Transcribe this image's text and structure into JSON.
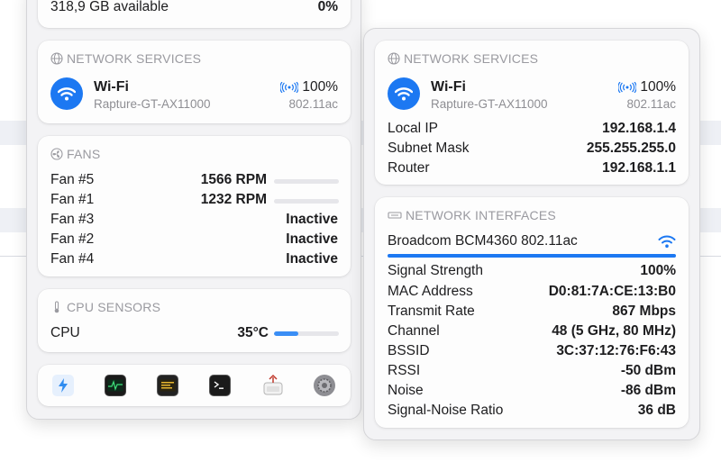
{
  "colors": {
    "accent": "#1c78f2",
    "header_text": "#9a9aa0",
    "card_bg": "#fdfdfd",
    "panel_bg": "#f3f3f5"
  },
  "left_panel": {
    "storage": {
      "available": "318,9 GB available",
      "percent": "0%"
    },
    "network_services": {
      "header": "NETWORK SERVICES",
      "wifi": {
        "name": "Wi-Fi",
        "ssid": "Rapture-GT-AX11000",
        "signal": "100%",
        "standard": "802.11ac"
      }
    },
    "fans": {
      "header": "FANS",
      "items": [
        {
          "name": "Fan #5",
          "value": "1566 RPM",
          "level": 0
        },
        {
          "name": "Fan #1",
          "value": "1232 RPM",
          "level": 0
        },
        {
          "name": "Fan #3",
          "value": "Inactive"
        },
        {
          "name": "Fan #2",
          "value": "Inactive"
        },
        {
          "name": "Fan #4",
          "value": "Inactive"
        }
      ]
    },
    "cpu_sensors": {
      "header": "CPU SENSORS",
      "label": "CPU",
      "value": "35°C",
      "level": 0.38
    },
    "dock": {
      "icons": [
        "bolt-app-icon",
        "activity-monitor-icon",
        "console-app-icon",
        "terminal-icon",
        "network-utility-icon",
        "system-settings-icon"
      ]
    }
  },
  "right_panel": {
    "network_services": {
      "header": "NETWORK SERVICES",
      "wifi": {
        "name": "Wi-Fi",
        "ssid": "Rapture-GT-AX11000",
        "signal": "100%",
        "standard": "802.11ac"
      },
      "rows": [
        {
          "label": "Local IP",
          "value": "192.168.1.4"
        },
        {
          "label": "Subnet Mask",
          "value": "255.255.255.0"
        },
        {
          "label": "Router",
          "value": "192.168.1.1"
        }
      ]
    },
    "network_interfaces": {
      "header": "NETWORK INTERFACES",
      "interface_name": "Broadcom BCM4360 802.11ac",
      "signal_level": 1.0,
      "rows": [
        {
          "label": "Signal Strength",
          "value": "100%"
        },
        {
          "label": "MAC Address",
          "value": "D0:81:7A:CE:13:B0"
        },
        {
          "label": "Transmit Rate",
          "value": "867 Mbps"
        },
        {
          "label": "Channel",
          "value": "48 (5 GHz, 80 MHz)"
        },
        {
          "label": "BSSID",
          "value": "3C:37:12:76:F6:43"
        },
        {
          "label": "RSSI",
          "value": "-50 dBm"
        },
        {
          "label": "Noise",
          "value": "-86 dBm"
        },
        {
          "label": "Signal-Noise Ratio",
          "value": "36 dB"
        }
      ]
    }
  }
}
